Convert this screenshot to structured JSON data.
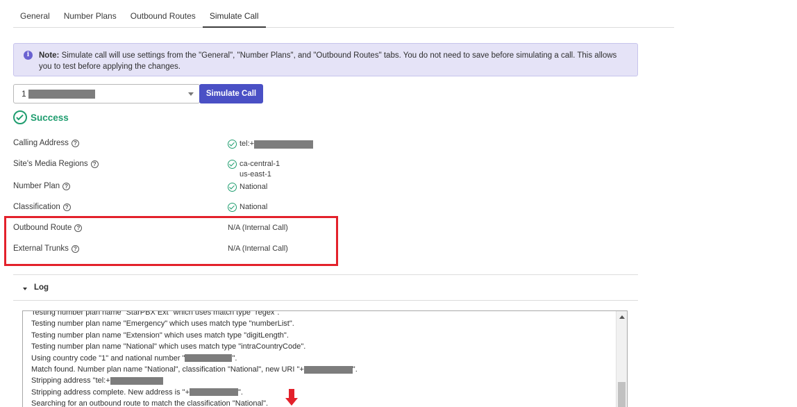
{
  "tabs": [
    {
      "label": "General",
      "active": false
    },
    {
      "label": "Number Plans",
      "active": false
    },
    {
      "label": "Outbound Routes",
      "active": false
    },
    {
      "label": "Simulate Call",
      "active": true
    }
  ],
  "note": {
    "bold": "Note:",
    "text": " Simulate call will use settings from the \"General\", \"Number Plans\", and \"Outbound Routes\" tabs. You do not need to save before simulating a call. This allows you to test before applying the changes."
  },
  "form": {
    "selected_prefix": "1",
    "simulate_label": "Simulate Call"
  },
  "result": {
    "status": "Success",
    "status_color": "#1f9d6f"
  },
  "details": {
    "calling_address": {
      "label": "Calling Address",
      "value_prefix": "tel:+"
    },
    "media_regions": {
      "label": "Site's Media Regions",
      "values": [
        "ca-central-1",
        "us-east-1"
      ]
    },
    "number_plan": {
      "label": "Number Plan",
      "value": "National"
    },
    "classification": {
      "label": "Classification",
      "value": "National"
    },
    "outbound_route": {
      "label": "Outbound Route",
      "value": "N/A (Internal Call)"
    },
    "external_trunks": {
      "label": "External Trunks",
      "value": "N/A (Internal Call)"
    }
  },
  "log": {
    "title": "Log",
    "lines": [
      {
        "text": "Testing number plan name \"StarPBX Ext\" which uses match type \"regex\"."
      },
      {
        "text": "Testing number plan name \"Emergency\" which uses match type \"numberList\"."
      },
      {
        "text": "Testing number plan name \"Extension\" which uses match type \"digitLength\"."
      },
      {
        "text": "Testing number plan name \"National\" which uses match type \"intraCountryCode\"."
      },
      {
        "before": "Using country code \"1\" and national number \"",
        "after": "\"."
      },
      {
        "before": "Match found. Number plan name \"National\", classification \"National\", new URI \"+",
        "after": "\"."
      },
      {
        "before": "Stripping address \"tel:+",
        "after": ""
      },
      {
        "before": "Stripping address complete. New address is \"+",
        "after": "\"."
      },
      {
        "text": "Searching for an outbound route to match the classification \"National\"."
      }
    ]
  },
  "colors": {
    "accent": "#4a50c5",
    "success": "#1f9d6f",
    "highlight": "#e3212b",
    "note_bg": "#e5e3f7"
  }
}
